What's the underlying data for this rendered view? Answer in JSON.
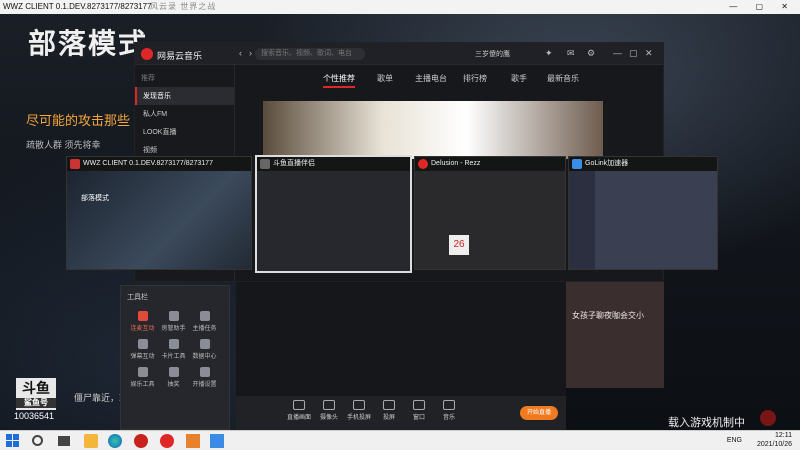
{
  "desktop": {
    "title_bar": "WWZ CLIENT 0.1.DEV.8273177/8273177",
    "overlay_title": "风云录  世界之战",
    "big_title": "部落模式",
    "subtitle": "尽可能的攻击那些",
    "description": "疏散人群 须先将幸",
    "bottom_text": "僵尸靠近，就",
    "loading_text": "载入游戏机制中",
    "logo_text": "斗鱼",
    "logo_sub": "鲨鱼号",
    "user_id": "10036541"
  },
  "music_app": {
    "title": "网易云音乐",
    "search_placeholder": "搜索音乐、视频、歌词、电台",
    "user": "三岁傻的鹰",
    "sidebar_header": "推荐",
    "sidebar_items": [
      "发现音乐",
      "私人FM",
      "LOOK直播",
      "视频"
    ],
    "tabs": [
      "个性推荐",
      "歌单",
      "主播电台",
      "排行榜",
      "歌手",
      "最新音乐"
    ],
    "accent": "#e02727"
  },
  "task_view": {
    "wwz": {
      "title": "WWZ CLIENT 0.1.DEV.8273177/8273177",
      "inner_title": "部落模式"
    },
    "douyu": {
      "title": "斗鱼直播伴侣"
    },
    "delusion": {
      "title": "Delusion - Rezz",
      "date": "26"
    },
    "golink": {
      "title": "GoLink加速器"
    }
  },
  "tools_panel": {
    "header": "工具栏",
    "items": [
      "连麦互动",
      "房管助手",
      "主播任务",
      "弹幕互动",
      "卡片工具",
      "数据中心",
      "娱乐工具",
      "抽奖",
      "开播设置",
      "游戏工具",
      "",
      "节奏工具"
    ]
  },
  "stream_bar": {
    "buttons": [
      "直播画面",
      "摄像头",
      "手机投屏",
      "投屏",
      "窗口",
      "游戏",
      "音乐"
    ],
    "live_button": "开始直播",
    "extra": "载入游戏机制中"
  },
  "right_card": {
    "text": "女孩子聊夜咖会交小"
  },
  "taskbar": {
    "language": "ENG",
    "time": "12:11",
    "date": "2021/10/26"
  }
}
